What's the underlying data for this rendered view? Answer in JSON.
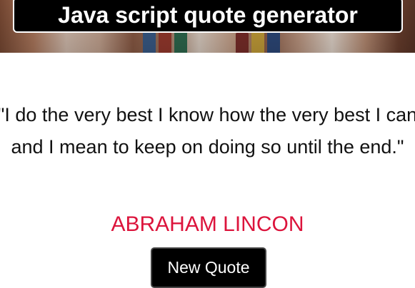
{
  "header": {
    "title": "Java script quote generator"
  },
  "quote": {
    "text": "\"I do the very best I know how the very best I can and I mean to keep on doing so until the end.\"",
    "author": "ABRAHAM LINCON"
  },
  "actions": {
    "new_quote_label": "New Quote"
  },
  "colors": {
    "author": "#dc143c",
    "button_bg": "#000000",
    "title_bg": "#000000"
  }
}
